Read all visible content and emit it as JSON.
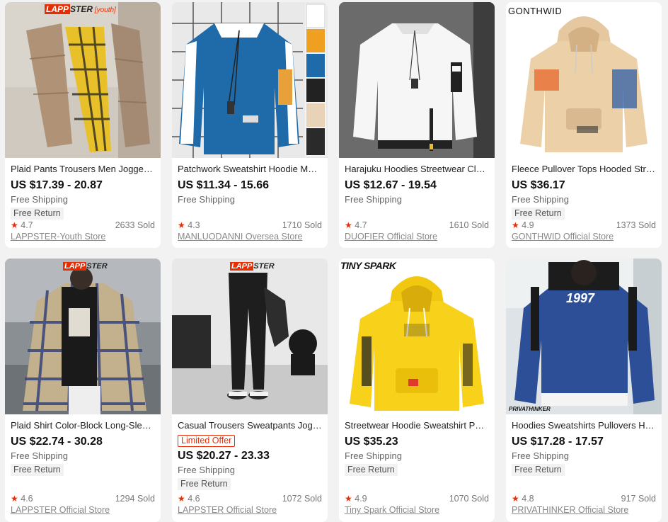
{
  "products": [
    {
      "title": "Plaid Pants Trousers Men Joggers ...",
      "price": "US $17.39 - 20.87",
      "shipping": "Free Shipping",
      "badge": "Free Return",
      "limited": "",
      "rating": "4.7",
      "sold": "2633 Sold",
      "store": "LAPPSTER-Youth Store",
      "brand_mark": "LAPPSTER[youth]"
    },
    {
      "title": "Patchwork Sweatshirt Hoodie Men...",
      "price": "US $11.34 - 15.66",
      "shipping": "Free Shipping",
      "badge": "",
      "limited": "",
      "rating": "4.3",
      "sold": "1710 Sold",
      "store": "MANLUODANNI Oversea Store",
      "brand_mark": ""
    },
    {
      "title": "Harajuku Hoodies Streetwear Clot...",
      "price": "US $12.67 - 19.54",
      "shipping": "Free Shipping",
      "badge": "",
      "limited": "",
      "rating": "4.7",
      "sold": "1610 Sold",
      "store": "DUOFIER Official Store",
      "brand_mark": ""
    },
    {
      "title": "Fleece Pullover Tops Hooded Stree...",
      "price": "US $36.17",
      "shipping": "Free Shipping",
      "badge": "Free Return",
      "limited": "",
      "rating": "4.9",
      "sold": "1373 Sold",
      "store": "GONTHWID Official Store",
      "brand_mark": "GONTHWID"
    },
    {
      "title": "Plaid Shirt Color-Block Long-Sleeve...",
      "price": "US $22.74 - 30.28",
      "shipping": "Free Shipping",
      "badge": "Free Return",
      "limited": "",
      "rating": "4.6",
      "sold": "1294 Sold",
      "store": "LAPPSTER Official Store",
      "brand_mark": "LAPPSTER"
    },
    {
      "title": "Casual Trousers Sweatpants Jogge...",
      "price": "US $20.27 - 23.33",
      "shipping": "Free Shipping",
      "badge": "Free Return",
      "limited": "Limited Offer",
      "rating": "4.6",
      "sold": "1072 Sold",
      "store": "LAPPSTER Official Store",
      "brand_mark": "LAPPSTER"
    },
    {
      "title": "Streetwear Hoodie Sweatshirt Pull...",
      "price": "US $35.23",
      "shipping": "Free Shipping",
      "badge": "Free Return",
      "limited": "",
      "rating": "4.9",
      "sold": "1070 Sold",
      "store": "Tiny Spark Official Store",
      "brand_mark": "TINY SPARK"
    },
    {
      "title": "Hoodies Sweatshirts Pullovers Har...",
      "price": "US $17.28 - 17.57",
      "shipping": "Free Shipping",
      "badge": "Free Return",
      "limited": "",
      "rating": "4.8",
      "sold": "917 Sold",
      "store": "PRIVATHINKER Official Store",
      "brand_mark": "PRIVATHINKER"
    }
  ],
  "icons": {
    "rating": "star-icon"
  },
  "colors": {
    "accent": "#e62e04",
    "card_bg": "#ffffff",
    "page_bg": "#f2f2f2"
  },
  "image_texts": {
    "print_1997": "1997"
  }
}
